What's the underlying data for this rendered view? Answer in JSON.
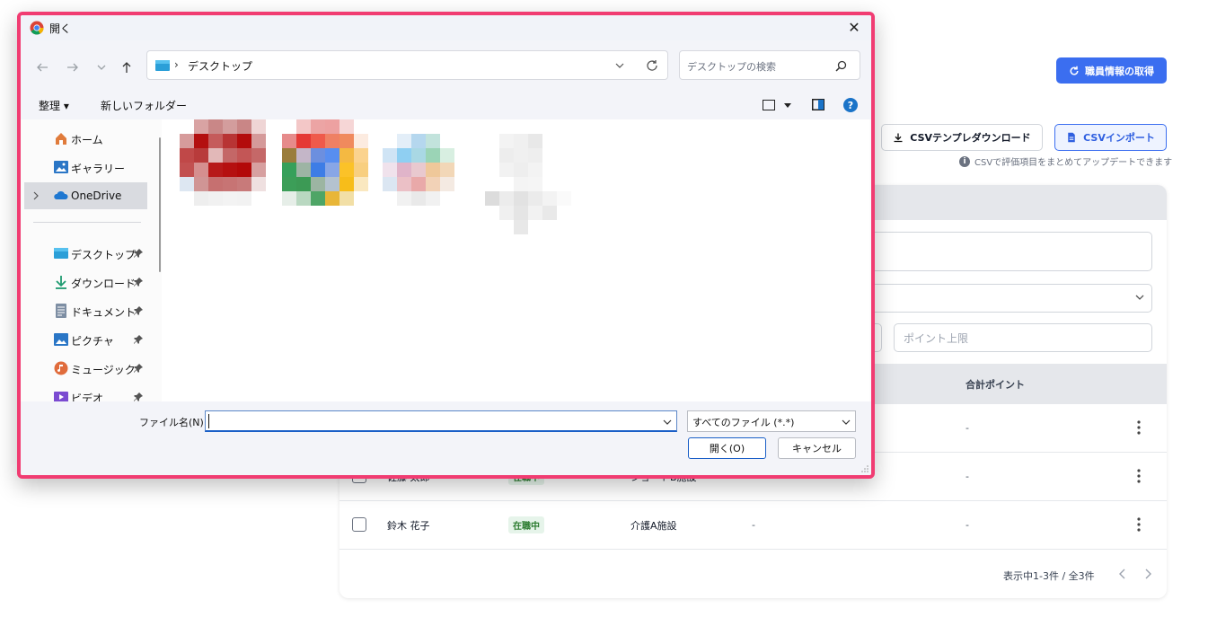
{
  "app": {
    "fetch_button": "職員情報の取得",
    "csv_download_button": "CSVテンプレダウンロード",
    "csv_import_button": "CSVインポート",
    "csv_note": "CSVで評価項目をまとめてアップデートできます",
    "filter": {
      "point_max_placeholder": "ポイント上限"
    },
    "table": {
      "headers": {
        "total_points": "合計ポイント"
      },
      "rows": [
        {
          "name": "",
          "status": "",
          "facility": "",
          "points": "",
          "total": "-"
        },
        {
          "name": "佐藤 太郎",
          "status": "在職中",
          "facility": "ショートB施設",
          "points": "",
          "total": "-"
        },
        {
          "name": "鈴木 花子",
          "status": "在職中",
          "facility": "介護A施設",
          "points": "-",
          "total": "-"
        }
      ]
    },
    "pagination": "表示中1-3件 / 全3件",
    "colors": {
      "primary": "#3b6ef0",
      "badge_bg": "#e6f4ea",
      "badge_text": "#2e7d32"
    }
  },
  "dialog": {
    "title": "開く",
    "close_glyph": "✕",
    "address": {
      "separator": "›",
      "path": "デスクトップ"
    },
    "search_placeholder": "デスクトップの検索",
    "toolbar": {
      "organize": "整理 ▾",
      "new_folder": "新しいフォルダー",
      "help": "?"
    },
    "sidebar": [
      {
        "label": "ホーム",
        "icon": "home-icon"
      },
      {
        "label": "ギャラリー",
        "icon": "gallery-icon"
      },
      {
        "label": "OneDrive",
        "icon": "onedrive-icon",
        "selected": true
      },
      {
        "label": "デスクトップ",
        "icon": "desktop-icon",
        "pinned": true
      },
      {
        "label": "ダウンロード",
        "icon": "download-icon",
        "pinned": true
      },
      {
        "label": "ドキュメント",
        "icon": "document-icon",
        "pinned": true
      },
      {
        "label": "ピクチャ",
        "icon": "pictures-icon",
        "pinned": true
      },
      {
        "label": "ミュージック",
        "icon": "music-icon",
        "pinned": true
      },
      {
        "label": "ビデオ",
        "icon": "video-icon",
        "pinned": true
      }
    ],
    "filename_label": "ファイル名(N):",
    "filename_value": "",
    "filetype": "すべてのファイル (*.*)",
    "open_button": "開く(O)",
    "cancel_button": "キャンセル",
    "colors": {
      "highlight_border": "#f13c72",
      "accent": "#1a5fc7"
    }
  }
}
